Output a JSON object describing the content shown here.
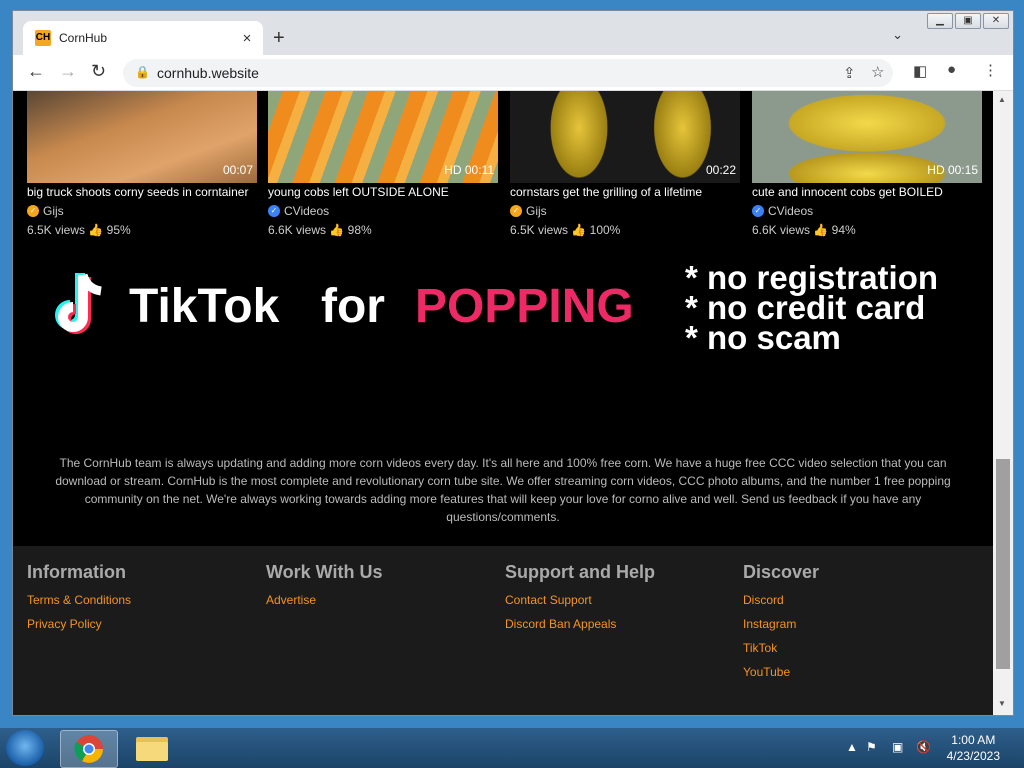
{
  "browser": {
    "tab_title": "CornHub",
    "favicon_text": "CH",
    "url": "cornhub.website"
  },
  "videos": [
    {
      "title": "big truck shoots corny seeds in corntainer",
      "duration": "00:07",
      "channel": "Gijs",
      "channel_badge_color": "#f7a51a",
      "views": "6.5K views",
      "rating": "95%"
    },
    {
      "title": "young cobs left OUTSIDE ALONE",
      "duration": "HD 00:11",
      "channel": "CVideos",
      "channel_badge_color": "#3b82f6",
      "views": "6.6K views",
      "rating": "98%"
    },
    {
      "title": "cornstars get the grilling of a lifetime",
      "duration": "00:22",
      "channel": "Gijs",
      "channel_badge_color": "#f7a51a",
      "views": "6.5K views",
      "rating": "100%"
    },
    {
      "title": "cute and innocent cobs get BOILED",
      "duration": "HD 00:15",
      "channel": "CVideos",
      "channel_badge_color": "#3b82f6",
      "views": "6.6K views",
      "rating": "94%"
    }
  ],
  "ad": {
    "brand": "TikTok",
    "for": "for",
    "popping": "POPPING",
    "line1": "* no registration",
    "line2": "* no credit card",
    "line3": "* no scam"
  },
  "about_text": "The CornHub team is always updating and adding more corn videos every day. It's all here and 100% free corn. We have a huge free CCC video selection that you can download or stream. CornHub is the most complete and revolutionary corn tube site. We offer streaming corn videos, CCC photo albums, and the number 1 free popping community on the net. We're always working towards adding more features that will keep your love for corno alive and well. Send us feedback if you have any questions/comments.",
  "footer": {
    "columns": [
      {
        "heading": "Information",
        "links": [
          "Terms & Conditions",
          "Privacy Policy"
        ]
      },
      {
        "heading": "Work With Us",
        "links": [
          "Advertise"
        ]
      },
      {
        "heading": "Support and Help",
        "links": [
          "Contact Support",
          "Discord Ban Appeals"
        ]
      },
      {
        "heading": "Discover",
        "links": [
          "Discord",
          "Instagram",
          "TikTok",
          "YouTube"
        ]
      }
    ]
  },
  "taskbar": {
    "time": "1:00 AM",
    "date": "4/23/2023"
  },
  "colors": {
    "accent": "#f7931e",
    "popping": "#ee2a66"
  }
}
